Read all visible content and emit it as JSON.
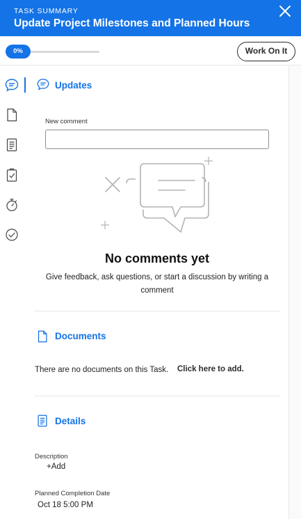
{
  "header": {
    "kicker": "TASK SUMMARY",
    "title": "Update Project Milestones and Planned Hours"
  },
  "progress": {
    "label": "0%",
    "value": 0
  },
  "actions": {
    "work_on_it": "Work On It"
  },
  "updates": {
    "title": "Updates",
    "new_comment_label": "New comment",
    "comment_value": "",
    "empty_title": "No comments yet",
    "empty_subtitle": "Give feedback, ask questions, or start a discussion by writing a comment"
  },
  "documents": {
    "title": "Documents",
    "empty_text": "There are no documents on this Task.",
    "add_link": "Click here to add."
  },
  "details": {
    "title": "Details",
    "description_label": "Description",
    "description_add": "+Add",
    "planned_completion_label": "Planned Completion Date",
    "planned_completion_value": "Oct 18 5:00 PM"
  },
  "colors": {
    "accent": "#1473e6",
    "text": "#2c2c2c",
    "divider": "#e6e6e6"
  },
  "rail_icons": [
    "comment-icon",
    "document-icon",
    "details-icon",
    "checklist-icon",
    "stopwatch-icon",
    "approval-check-icon"
  ]
}
